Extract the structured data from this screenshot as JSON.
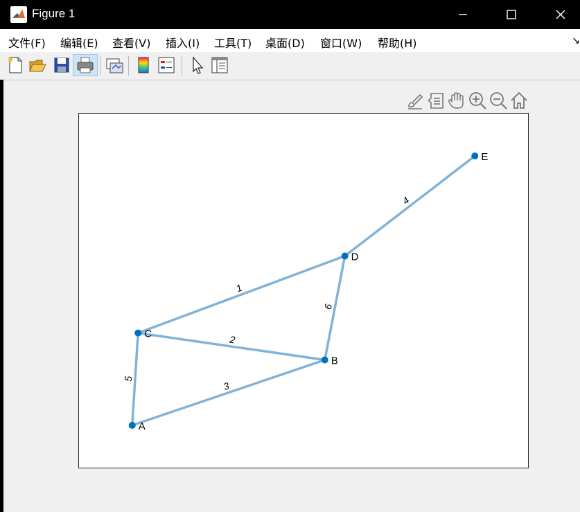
{
  "window": {
    "title": "Figure 1"
  },
  "menu": {
    "items": [
      {
        "label": "文件(F)"
      },
      {
        "label": "编辑(E)"
      },
      {
        "label": "查看(V)"
      },
      {
        "label": "插入(I)"
      },
      {
        "label": "工具(T)"
      },
      {
        "label": "桌面(D)"
      },
      {
        "label": "窗口(W)"
      },
      {
        "label": "帮助(H)"
      }
    ]
  },
  "toolbar": {
    "icons": [
      "new-figure-icon",
      "open-file-icon",
      "save-icon",
      "print-icon",
      "link-plot-icon",
      "colorbar-icon",
      "legend-icon",
      "edit-plot-icon",
      "property-inspector-icon"
    ]
  },
  "axes_toolbar": {
    "icons": [
      "brush-icon",
      "data-tips-icon",
      "pan-icon",
      "zoom-in-icon",
      "zoom-out-icon",
      "home-icon"
    ]
  },
  "colors": {
    "node": "#0072bd",
    "edge": "#80b3da",
    "text": "#000000"
  },
  "chart_data": {
    "type": "graph",
    "xlim": [
      0.6,
      4.4
    ],
    "ylim": [
      -0.4,
      4.2
    ],
    "nodes": [
      {
        "name": "A",
        "x": 1.05,
        "y": 0.15
      },
      {
        "name": "B",
        "x": 2.68,
        "y": 1.0
      },
      {
        "name": "C",
        "x": 1.1,
        "y": 1.35
      },
      {
        "name": "D",
        "x": 2.85,
        "y": 2.35
      },
      {
        "name": "E",
        "x": 3.95,
        "y": 3.65
      }
    ],
    "edges": [
      {
        "from": "C",
        "to": "D",
        "weight": "1"
      },
      {
        "from": "C",
        "to": "B",
        "weight": "2"
      },
      {
        "from": "A",
        "to": "B",
        "weight": "3"
      },
      {
        "from": "D",
        "to": "E",
        "weight": "4"
      },
      {
        "from": "A",
        "to": "C",
        "weight": "5"
      },
      {
        "from": "B",
        "to": "D",
        "weight": "6"
      }
    ]
  }
}
